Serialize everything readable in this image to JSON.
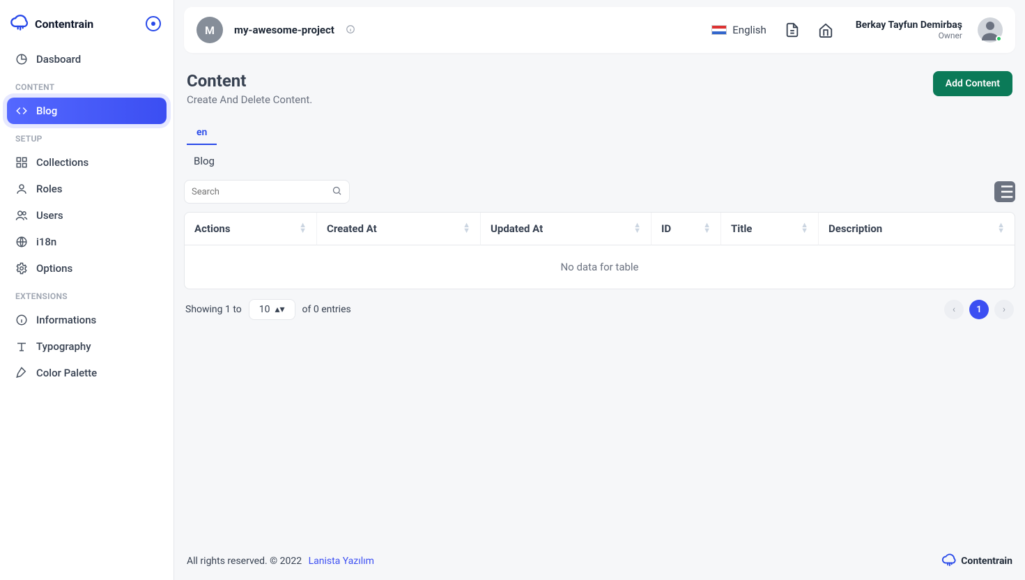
{
  "brand": {
    "name": "Contentrain"
  },
  "sidebar": {
    "dashboard": "Dasboard",
    "sections": {
      "content": "CONTENT",
      "setup": "SETUP",
      "extensions": "EXTENSIONS"
    },
    "items": {
      "blog": "Blog",
      "collections": "Collections",
      "roles": "Roles",
      "users": "Users",
      "i18n": "i18n",
      "options": "Options",
      "informations": "Informations",
      "typography": "Typography",
      "color_palette": "Color Palette"
    }
  },
  "topbar": {
    "project_initial": "M",
    "project_name": "my-awesome-project",
    "language": "English",
    "user": {
      "name": "Berkay Tayfun Demirbaş",
      "role": "Owner"
    }
  },
  "page": {
    "title": "Content",
    "subtitle": "Create And Delete Content.",
    "add_button": "Add Content",
    "tab": "en",
    "collection": "Blog",
    "search_placeholder": "Search",
    "columns": {
      "actions": "Actions",
      "created_at": "Created At",
      "updated_at": "Updated At",
      "id": "ID",
      "title": "Title",
      "description": "Description"
    },
    "empty": "No data for table",
    "showing_before": "Showing 1 to",
    "showing_after": "of 0 entries",
    "page_size": "10",
    "page_number": "1"
  },
  "footer": {
    "text": "All rights reserved. © 2022",
    "link": "Lanista Yazılım",
    "brand": "Contentrain"
  }
}
